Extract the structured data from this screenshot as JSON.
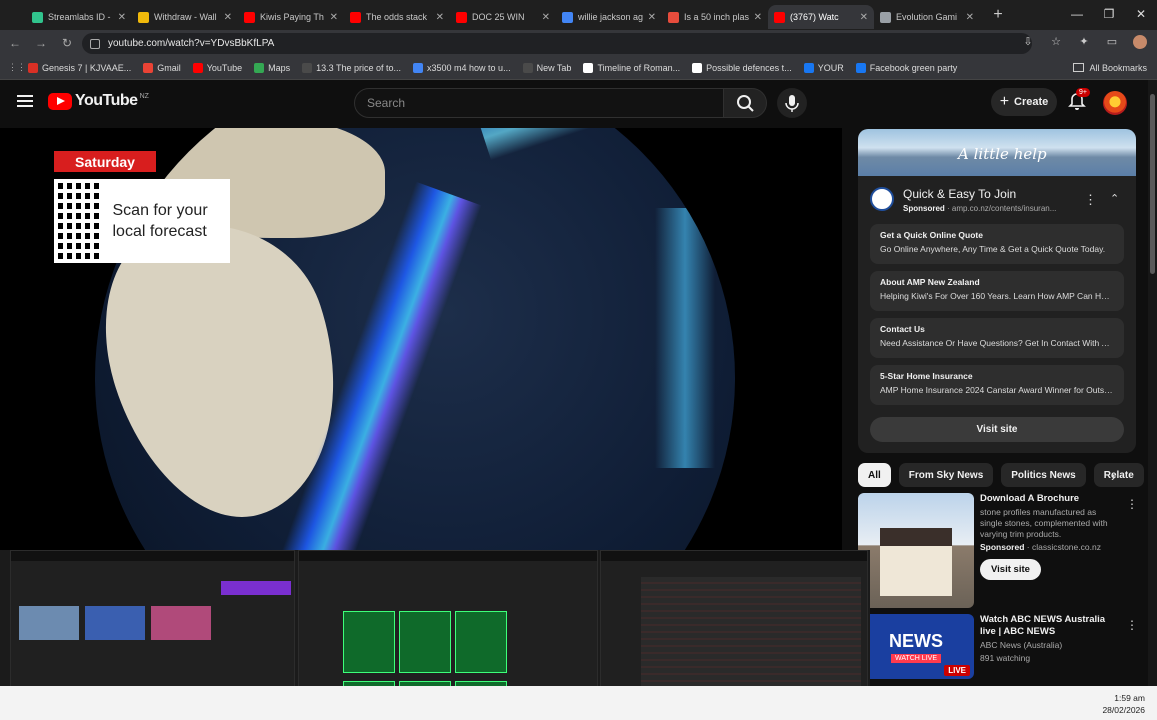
{
  "browser": {
    "tabs": [
      {
        "title": "Streamlabs ID -",
        "color": "#31c48d"
      },
      {
        "title": "Withdraw - Wall",
        "color": "#f0b90b"
      },
      {
        "title": "Kiwis Paying Th",
        "color": "#ff0000"
      },
      {
        "title": "The odds stack",
        "color": "#ff0000"
      },
      {
        "title": "DOC 25 WIN",
        "color": "#ff0000"
      },
      {
        "title": "willie jackson ag",
        "color": "#4285f4"
      },
      {
        "title": "Is a 50 inch plas",
        "color": "#e74c3c"
      },
      {
        "title": "(3767) Watc",
        "color": "#ff0000"
      },
      {
        "title": "Evolution Gami",
        "color": "#9aa0a6"
      }
    ],
    "active_tab_index": 7,
    "url": "youtube.com/watch?v=YDvsBbKfLPA",
    "bookmarks": [
      {
        "label": "Genesis 7 | KJVAAE...",
        "color": "#d93025"
      },
      {
        "label": "Gmail",
        "color": "#ea4335"
      },
      {
        "label": "YouTube",
        "color": "#ff0000"
      },
      {
        "label": "Maps",
        "color": "#34a853"
      },
      {
        "label": "13.3 The price of to...",
        "color": "#4a4a4a"
      },
      {
        "label": "x3500 m4 how to u...",
        "color": "#4285f4"
      },
      {
        "label": "New Tab",
        "color": "#4a4a4a"
      },
      {
        "label": "Timeline of Roman...",
        "color": "#ffffff"
      },
      {
        "label": "Possible defences t...",
        "color": "#ffffff"
      },
      {
        "label": "YOUR",
        "color": "#1877f2"
      },
      {
        "label": "Facebook green party",
        "color": "#1877f2"
      }
    ],
    "all_bookmarks": "All Bookmarks"
  },
  "youtube": {
    "logo_text": "YouTube",
    "region": "NZ",
    "search_placeholder": "Search",
    "create_label": "Create",
    "notifications": "9+"
  },
  "video": {
    "day_label": "Saturday",
    "qr_text": "Scan for your local forecast"
  },
  "ad": {
    "banner_text": "A little help",
    "title": "Quick & Easy To Join",
    "sponsored": "Sponsored",
    "domain": "amp.co.nz/contents/insuran...",
    "links": [
      {
        "heading": "Get a Quick Online Quote",
        "desc": "Go Online Anywhere, Any Time & Get a Quick Quote Today."
      },
      {
        "heading": "About AMP New Zealand",
        "desc": "Helping Kiwi's For Over 160 Years. Learn How AMP Can Help ..."
      },
      {
        "heading": "Contact Us",
        "desc": "Need Assistance Or Have Questions? Get In Contact With AM..."
      },
      {
        "heading": "5-Star Home Insurance",
        "desc": "AMP Home Insurance 2024 Canstar Award Winner for Outsta..."
      }
    ],
    "visit_label": "Visit site"
  },
  "chips": [
    "All",
    "From Sky News",
    "Politics News",
    "Relate"
  ],
  "sidebar_videos": [
    {
      "title": "Download A Brochure",
      "desc": "stone profiles manufactured as single stones, complemented with varying trim products.",
      "sponsored": "Sponsored",
      "domain": "classicstone.co.nz",
      "visit": "Visit site"
    },
    {
      "title": "Watch ABC NEWS Australia live | ABC NEWS",
      "channel": "ABC News (Australia)",
      "views": "891 watching",
      "thumb_brand": "NEWS",
      "thumb_sub": "WATCH LIVE",
      "live": "LIVE"
    }
  ],
  "taskbar": {
    "time": "1:59 am",
    "date": "28/02/2026"
  }
}
